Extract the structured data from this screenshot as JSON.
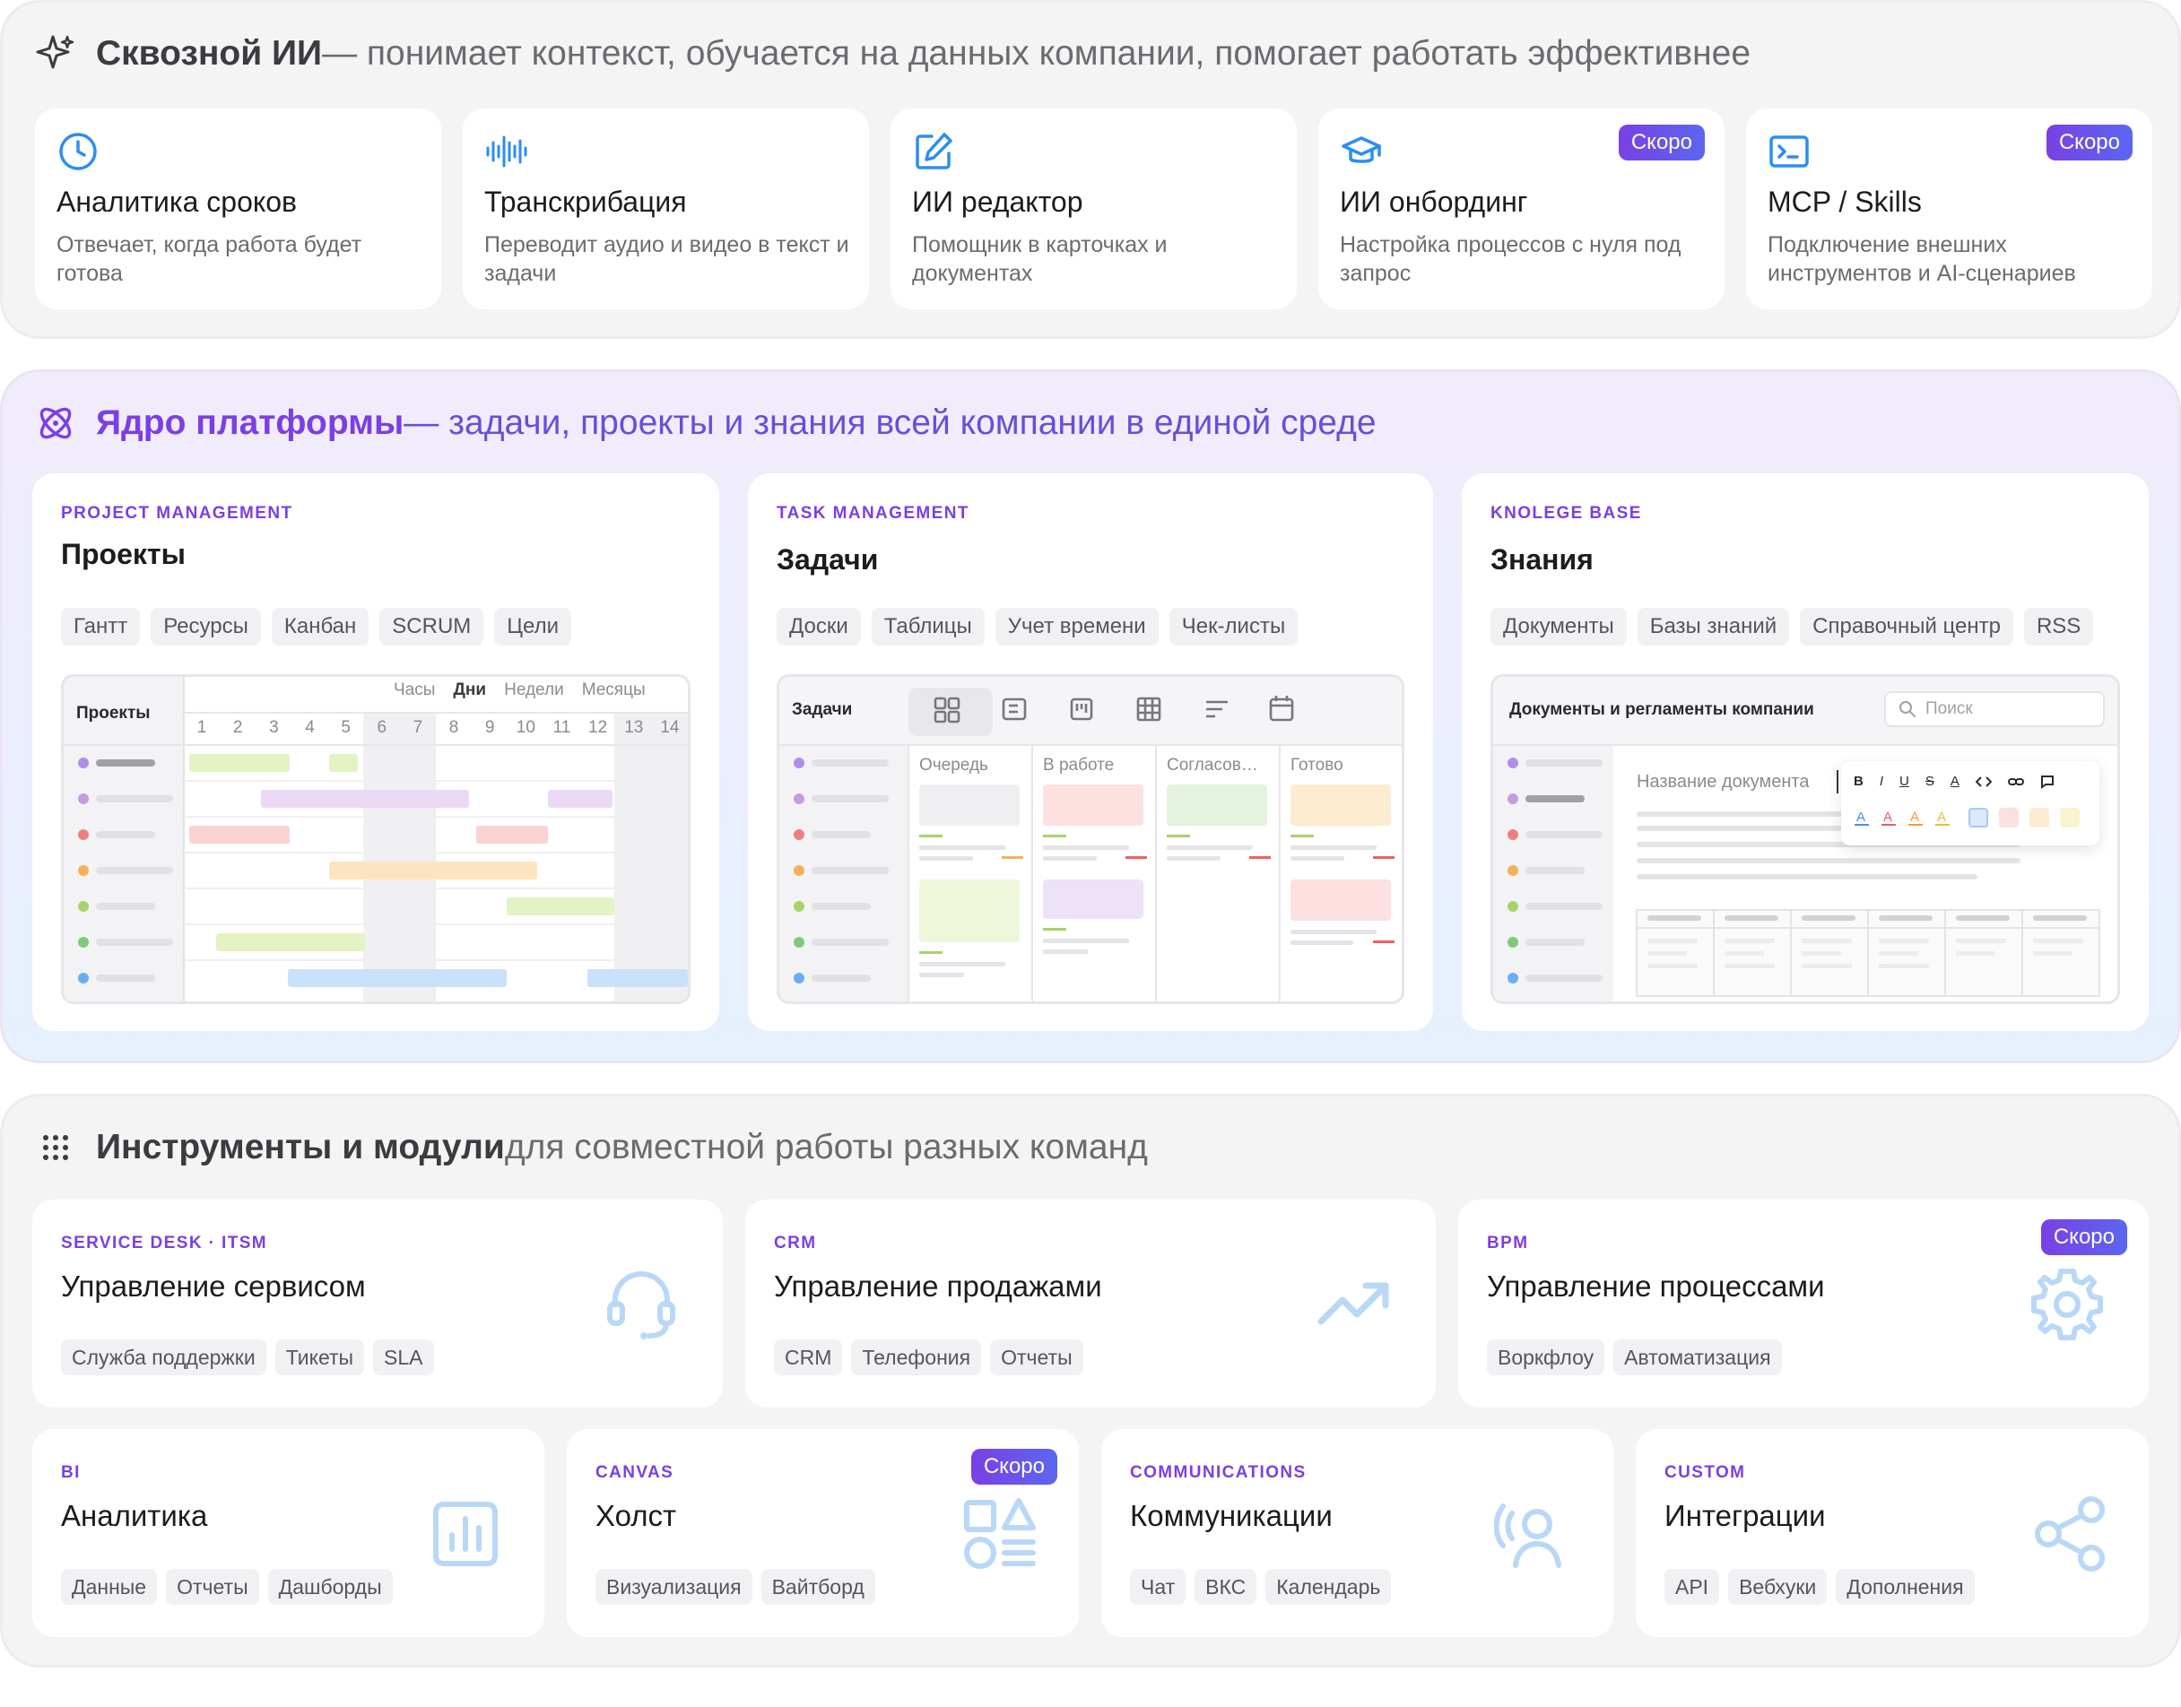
{
  "ai": {
    "title_bold": "Сквозной ИИ",
    "title_rest": " — понимает контекст, обучается на данных компании, помогает работать эффективнее",
    "cards": [
      {
        "title": "Аналитика сроков",
        "desc": "Отвечает, когда работа будет готова",
        "icon": "clock-icon",
        "badge": ""
      },
      {
        "title": "Транскрибация",
        "desc": "Переводит аудио и видео в текст и задачи",
        "icon": "audio-wave-icon",
        "badge": ""
      },
      {
        "title": "ИИ редактор",
        "desc": "Помощник в карточках и документах",
        "icon": "edit-icon",
        "badge": ""
      },
      {
        "title": "ИИ онбординг",
        "desc": "Настройка процессов с нуля под запрос",
        "icon": "graduation-cap-icon",
        "badge": "Скоро"
      },
      {
        "title": "MCP / Skills",
        "desc": "Подключение внешних инструментов и AI-сценариев",
        "icon": "terminal-icon",
        "badge": "Скоро"
      }
    ]
  },
  "core": {
    "title_bold": "Ядро платформы",
    "title_rest": " — задачи, проекты и знания всей компании в единой среде",
    "projects": {
      "category": "PROJECT MANAGEMENT",
      "title": "Проекты",
      "chips": [
        "Гантт",
        "Ресурсы",
        "Канбан",
        "SCRUM",
        "Цели"
      ],
      "mock_title": "Проекты",
      "scales": [
        "Часы",
        "Дни",
        "Недели",
        "Месяцы"
      ],
      "days": [
        "1",
        "2",
        "3",
        "4",
        "5",
        "6",
        "7",
        "8",
        "9",
        "10",
        "11",
        "12",
        "13",
        "14"
      ]
    },
    "tasks": {
      "category": "TASK MANAGEMENT",
      "title": "Задачи",
      "chips": [
        "Доски",
        "Таблицы",
        "Учет времени",
        "Чек-листы"
      ],
      "mock_title": "Задачи",
      "columns": [
        "Очередь",
        "В работе",
        "Согласов…",
        "Готово"
      ]
    },
    "knowledge": {
      "category": "KNOLEGE BASE",
      "title": "Знания",
      "chips": [
        "Документы",
        "Базы знаний",
        "Справочный центр",
        "RSS"
      ],
      "mock_title": "Документы и регламенты компании",
      "search_placeholder": "Поиск",
      "doc_placeholder": "Название документа",
      "toolbar": [
        "B",
        "I",
        "U",
        "S",
        "A"
      ]
    }
  },
  "tools": {
    "title_bold": "Инструменты и модули",
    "title_rest": " для совместной работы разных команд",
    "cards": [
      {
        "category": "SERVICE DESK · ITSM",
        "title": "Управление сервисом",
        "chips": [
          "Служба поддержки",
          "Тикеты",
          "SLA"
        ],
        "icon": "headset-icon",
        "badge": ""
      },
      {
        "category": "CRM",
        "title": "Управление продажами",
        "chips": [
          "CRM",
          "Телефония",
          "Отчеты"
        ],
        "icon": "trending-up-icon",
        "badge": ""
      },
      {
        "category": "BPM",
        "title": "Управление процессами",
        "chips": [
          "Воркфлоу",
          "Автоматизация"
        ],
        "icon": "gear-icon",
        "badge": "Скоро"
      },
      {
        "category": "BI",
        "title": "Аналитика",
        "chips": [
          "Данные",
          "Отчеты",
          "Дашборды"
        ],
        "icon": "bar-chart-icon",
        "badge": ""
      },
      {
        "category": "CANVAS",
        "title": "Холст",
        "chips": [
          "Визуализация",
          "Вайтборд"
        ],
        "icon": "shapes-icon",
        "badge": "Скоро"
      },
      {
        "category": "COMMUNICATIONS",
        "title": "Коммуникации",
        "chips": [
          "Чат",
          "ВКС",
          "Календарь"
        ],
        "icon": "broadcast-user-icon",
        "badge": ""
      },
      {
        "category": "CUSTOM",
        "title": "Интеграции",
        "chips": [
          "API",
          "Вебхуки",
          "Дополнения"
        ],
        "icon": "share-icon",
        "badge": ""
      }
    ]
  },
  "colors": {
    "accent": "#7b3fe4",
    "blue": "#2b8ef0",
    "icon_light": "#b9d8f7"
  }
}
